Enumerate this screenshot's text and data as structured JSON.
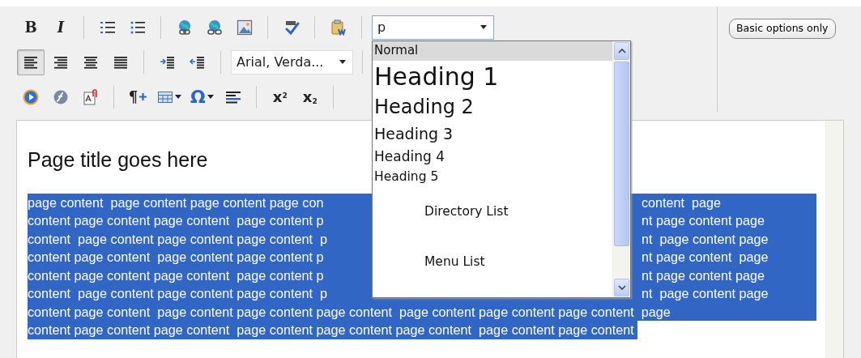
{
  "toolbar": {
    "rows": [
      [
        {
          "kind": "button",
          "text": "B",
          "pressed": false,
          "has_menu": false
        },
        {
          "kind": "button",
          "text": "I",
          "pressed": false,
          "has_menu": false
        },
        {
          "kind": "sep"
        },
        {
          "kind": "button",
          "pressed": false,
          "has_menu": false
        },
        {
          "kind": "button",
          "pressed": false,
          "has_menu": false
        },
        {
          "kind": "sep"
        },
        {
          "kind": "button",
          "pressed": false,
          "has_menu": false
        },
        {
          "kind": "button",
          "pressed": false,
          "has_menu": false
        },
        {
          "kind": "button",
          "pressed": false,
          "has_menu": false
        },
        {
          "kind": "sep"
        },
        {
          "kind": "button",
          "pressed": false,
          "has_menu": false
        },
        {
          "kind": "sep"
        },
        {
          "kind": "button",
          "pressed": false,
          "has_menu": false
        },
        {
          "kind": "sep"
        },
        {
          "kind": "select",
          "value": "p",
          "open": true,
          "options": [
            {
              "label": "Normal",
              "selected": true
            },
            {
              "label": "Heading 1",
              "selected": false
            },
            {
              "label": "Heading 2",
              "selected": false
            },
            {
              "label": "Heading 3",
              "selected": false
            },
            {
              "label": "Heading 4",
              "selected": false
            },
            {
              "label": "Heading 5",
              "selected": false
            },
            {
              "label": "Directory List",
              "selected": false
            },
            {
              "label": "Menu List",
              "selected": false
            }
          ]
        }
      ],
      [
        {
          "kind": "button",
          "pressed": true,
          "has_menu": false
        },
        {
          "kind": "button",
          "pressed": false,
          "has_menu": false
        },
        {
          "kind": "button",
          "pressed": false,
          "has_menu": false
        },
        {
          "kind": "button",
          "pressed": false,
          "has_menu": false
        },
        {
          "kind": "sep"
        },
        {
          "kind": "button",
          "pressed": false,
          "has_menu": false
        },
        {
          "kind": "button",
          "pressed": false,
          "has_menu": false
        },
        {
          "kind": "sep"
        },
        {
          "kind": "select",
          "value": "Arial, Verda..."
        },
        {
          "kind": "sep"
        }
      ],
      [
        {
          "kind": "button",
          "pressed": false,
          "has_menu": false
        },
        {
          "kind": "button",
          "pressed": false,
          "has_menu": false
        },
        {
          "kind": "button",
          "pressed": false,
          "has_menu": false
        },
        {
          "kind": "sep"
        },
        {
          "kind": "button",
          "text": "¶",
          "pressed": false,
          "has_menu": false
        },
        {
          "kind": "button",
          "pressed": false,
          "has_menu": true
        },
        {
          "kind": "button",
          "text": "Ω",
          "pressed": false,
          "has_menu": true
        },
        {
          "kind": "button",
          "pressed": false,
          "has_menu": false
        },
        {
          "kind": "sep"
        },
        {
          "kind": "button",
          "text": "x$^{2}$",
          "pressed": false,
          "has_menu": false
        },
        {
          "kind": "button",
          "text": "x$_{2}$",
          "pressed": false,
          "has_menu": false
        },
        {
          "kind": "sep"
        }
      ]
    ]
  },
  "options_button": "Basic options only",
  "editor": {
    "title": "Page title goes here",
    "paragraph": {
      "selected": true,
      "lines": [
        {
          "left": "page content  page content page content page con",
          "right": "content  page"
        },
        {
          "left": "content page content page content  page content p",
          "right": "nt page content page"
        },
        {
          "left": "content  page content page content page content  p",
          "right": "nt  page content page"
        },
        {
          "left": "content page content  page content page content p",
          "right": "nt page content  page"
        },
        {
          "left": "content page content page content  page content p",
          "right": "nt page content page"
        },
        {
          "left": "content  page content page content page content  p",
          "right": "nt  page content page"
        },
        {
          "left": "content page content  page content page content page content  page content page content page content  page"
        },
        {
          "left": "content page content page content  page content page content page content  page content page content"
        }
      ]
    }
  }
}
